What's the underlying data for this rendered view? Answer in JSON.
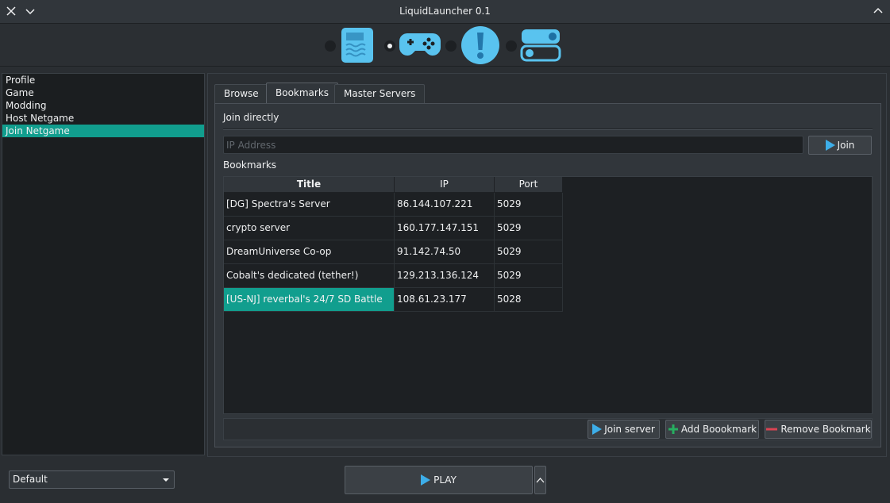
{
  "window": {
    "title": "LiquidLauncher 0.1"
  },
  "nav": {
    "icons": [
      "document-icon",
      "gamepad-icon",
      "exclamation-icon",
      "toggle-settings-icon"
    ]
  },
  "sidebar": {
    "items": [
      {
        "label": "Profile",
        "selected": false
      },
      {
        "label": "Game",
        "selected": false
      },
      {
        "label": "Modding",
        "selected": false
      },
      {
        "label": "Host Netgame",
        "selected": false
      },
      {
        "label": "Join Netgame",
        "selected": true
      }
    ]
  },
  "tabs": [
    {
      "label": "Browse",
      "active": false
    },
    {
      "label": "Bookmarks",
      "active": true
    },
    {
      "label": "Master Servers",
      "active": false
    }
  ],
  "join_directly": {
    "label": "Join directly",
    "ip_placeholder": "IP Address",
    "ip_value": "",
    "join_label": "Join"
  },
  "bookmarks": {
    "label": "Bookmarks",
    "columns": [
      "Title",
      "IP",
      "Port"
    ],
    "rows": [
      {
        "title": "[DG] Spectra's Server",
        "ip": "86.144.107.221",
        "port": "5029",
        "selected": false
      },
      {
        "title": "crypto server",
        "ip": "160.177.147.151",
        "port": "5029",
        "selected": false
      },
      {
        "title": "DreamUniverse Co-op",
        "ip": "91.142.74.50",
        "port": "5029",
        "selected": false
      },
      {
        "title": "Cobalt's dedicated (tether!)",
        "ip": "129.213.136.124",
        "port": "5029",
        "selected": false
      },
      {
        "title": "[US-NJ] reverbal's 24/7 SD Battle",
        "ip": "108.61.23.177",
        "port": "5028",
        "selected": true
      }
    ],
    "join_server_label": "Join server",
    "add_label": "Add Boookmark",
    "remove_label": "Remove Bookmark"
  },
  "bottom": {
    "profile_selected": "Default",
    "play_label": "PLAY"
  },
  "colors": {
    "accent": "#119e8e",
    "play_icon": "#3daee9",
    "add_icon": "#27ae60",
    "remove_icon": "#da4453"
  }
}
